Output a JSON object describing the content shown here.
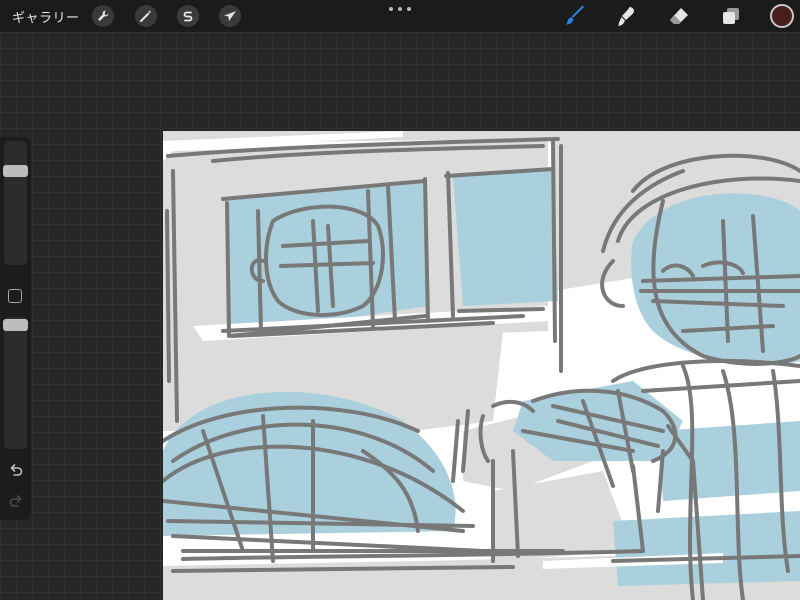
{
  "topbar": {
    "gallery_label": "ギャラリー",
    "left_tools": [
      {
        "name": "actions",
        "icon": "wrench-icon"
      },
      {
        "name": "adjustments",
        "icon": "magic-wand-icon"
      },
      {
        "name": "selection",
        "icon": "selection-s-icon"
      },
      {
        "name": "transform",
        "icon": "arrow-cursor-icon"
      }
    ],
    "more_icon": "more-dots-icon",
    "right_tools": [
      {
        "name": "brush",
        "icon": "brush-icon",
        "active": true
      },
      {
        "name": "smudge",
        "icon": "smudge-icon"
      },
      {
        "name": "eraser",
        "icon": "eraser-icon"
      },
      {
        "name": "layers",
        "icon": "layers-icon"
      }
    ],
    "current_color": "#4a1f1b",
    "accent_color": "#2a7fe0"
  },
  "sidebar": {
    "brush_size": 0.8,
    "opacity": 1.0,
    "undo_icon": "undo-icon",
    "redo_icon": "redo-icon",
    "modify_icon": "square-icon"
  },
  "canvas": {
    "background": "#ffffff",
    "palette": {
      "gray": "#dcdcdc",
      "blue": "#a9d0dc",
      "line": "#787878"
    }
  }
}
